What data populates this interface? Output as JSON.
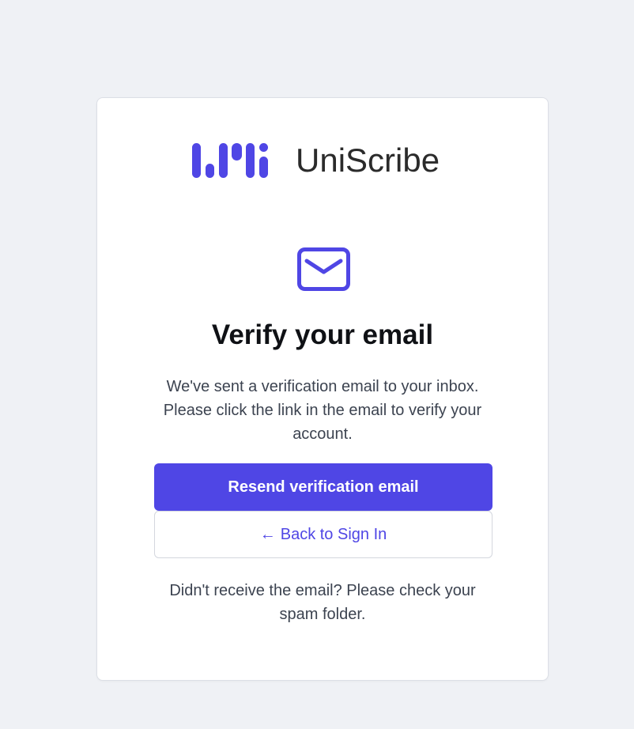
{
  "brand": {
    "name": "UniScribe",
    "accent_color": "#4f46e5",
    "logo_icon": "uniscribe-logo-mark"
  },
  "verify": {
    "icon": "mail-icon",
    "title": "Verify your email",
    "description": "We've sent a verification email to your inbox. Please click the link in the email to verify your account.",
    "resend_label": "Resend verification email",
    "back_arrow": "←",
    "back_label": "Back to Sign In",
    "footer_note": "Didn't receive the email? Please check your spam folder."
  }
}
